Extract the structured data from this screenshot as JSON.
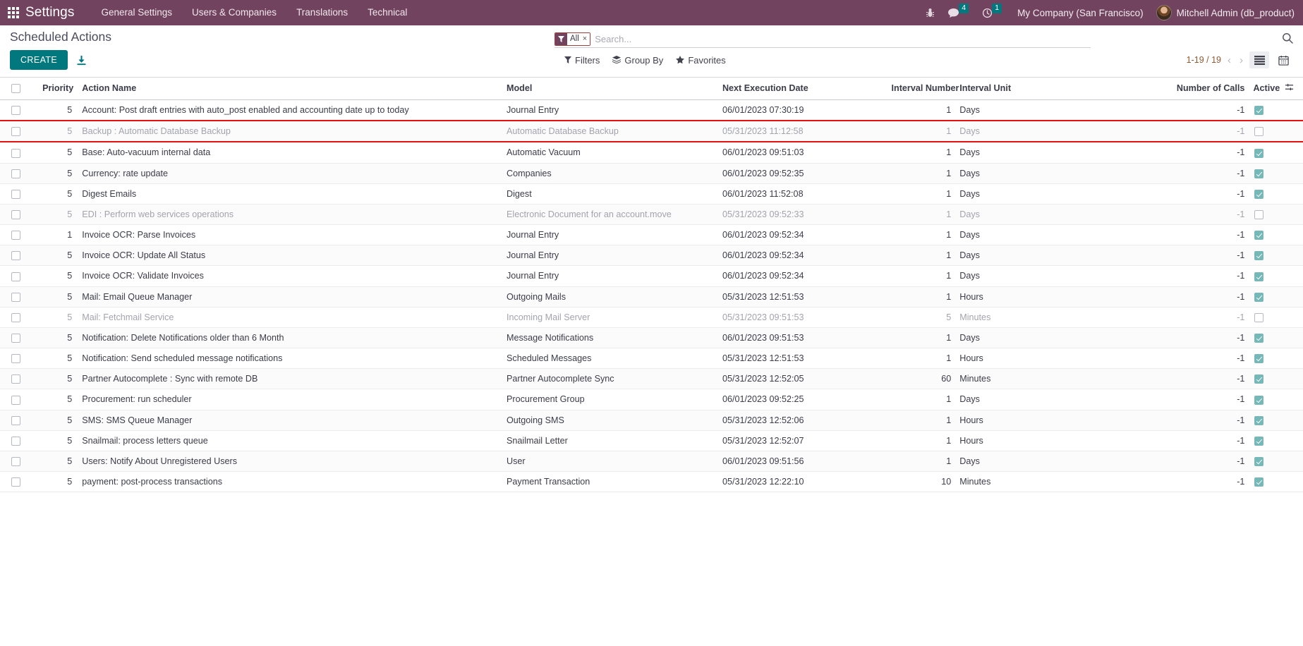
{
  "navbar": {
    "apps_icon": "apps-grid-icon",
    "brand": "Settings",
    "menu": [
      {
        "label": "General Settings"
      },
      {
        "label": "Users & Companies"
      },
      {
        "label": "Translations"
      },
      {
        "label": "Technical"
      }
    ],
    "debug_icon": "bug-icon",
    "messages": {
      "icon": "messages-icon",
      "count": "4"
    },
    "activities": {
      "icon": "clock-icon",
      "count": "1"
    },
    "company": "My Company (San Francisco)",
    "user": "Mitchell Admin (db_product)",
    "accent_color": "#71435f",
    "badge_color": "#00787d"
  },
  "control_panel": {
    "breadcrumb": "Scheduled Actions",
    "create_label": "CREATE",
    "upload_icon": "upload-icon",
    "search": {
      "facet_icon": "filter-icon",
      "facet_label": "All",
      "facet_remove": "×",
      "placeholder": "Search...",
      "value": "",
      "magnifier_icon": "search-icon"
    },
    "filters": [
      {
        "label": "Filters",
        "icon": "filter-icon"
      },
      {
        "label": "Group By",
        "icon": "layers-icon"
      },
      {
        "label": "Favorites",
        "icon": "star-icon"
      }
    ],
    "pager": {
      "value": "1-19 / 19",
      "prev_icon": "chevron-left-icon",
      "next_icon": "chevron-right-icon"
    },
    "views": [
      {
        "name": "list-view",
        "icon": "list-icon",
        "active": true
      },
      {
        "name": "calendar-view",
        "icon": "calendar-icon",
        "active": false
      }
    ]
  },
  "table": {
    "columns": [
      "Priority",
      "Action Name",
      "Model",
      "Next Execution Date",
      "Interval Number",
      "Interval Unit",
      "Number of Calls",
      "Active"
    ],
    "options_icon": "column-options-icon",
    "rows": [
      {
        "priority": "5",
        "name": "Account: Post draft entries with auto_post enabled and accounting date up to today",
        "model": "Journal Entry",
        "next_exec": "06/01/2023 07:30:19",
        "interval_number": "1",
        "interval_unit": "Days",
        "number_of_calls": "-1",
        "active": true,
        "muted": false,
        "highlighted": false
      },
      {
        "priority": "5",
        "name": "Backup : Automatic Database Backup",
        "model": "Automatic Database Backup",
        "next_exec": "05/31/2023 11:12:58",
        "interval_number": "1",
        "interval_unit": "Days",
        "number_of_calls": "-1",
        "active": false,
        "muted": true,
        "highlighted": true
      },
      {
        "priority": "5",
        "name": "Base: Auto-vacuum internal data",
        "model": "Automatic Vacuum",
        "next_exec": "06/01/2023 09:51:03",
        "interval_number": "1",
        "interval_unit": "Days",
        "number_of_calls": "-1",
        "active": true,
        "muted": false,
        "highlighted": false
      },
      {
        "priority": "5",
        "name": "Currency: rate update",
        "model": "Companies",
        "next_exec": "06/01/2023 09:52:35",
        "interval_number": "1",
        "interval_unit": "Days",
        "number_of_calls": "-1",
        "active": true,
        "muted": false,
        "highlighted": false
      },
      {
        "priority": "5",
        "name": "Digest Emails",
        "model": "Digest",
        "next_exec": "06/01/2023 11:52:08",
        "interval_number": "1",
        "interval_unit": "Days",
        "number_of_calls": "-1",
        "active": true,
        "muted": false,
        "highlighted": false
      },
      {
        "priority": "5",
        "name": "EDI : Perform web services operations",
        "model": "Electronic Document for an account.move",
        "next_exec": "05/31/2023 09:52:33",
        "interval_number": "1",
        "interval_unit": "Days",
        "number_of_calls": "-1",
        "active": false,
        "muted": true,
        "highlighted": false
      },
      {
        "priority": "1",
        "name": "Invoice OCR: Parse Invoices",
        "model": "Journal Entry",
        "next_exec": "06/01/2023 09:52:34",
        "interval_number": "1",
        "interval_unit": "Days",
        "number_of_calls": "-1",
        "active": true,
        "muted": false,
        "highlighted": false
      },
      {
        "priority": "5",
        "name": "Invoice OCR: Update All Status",
        "model": "Journal Entry",
        "next_exec": "06/01/2023 09:52:34",
        "interval_number": "1",
        "interval_unit": "Days",
        "number_of_calls": "-1",
        "active": true,
        "muted": false,
        "highlighted": false
      },
      {
        "priority": "5",
        "name": "Invoice OCR: Validate Invoices",
        "model": "Journal Entry",
        "next_exec": "06/01/2023 09:52:34",
        "interval_number": "1",
        "interval_unit": "Days",
        "number_of_calls": "-1",
        "active": true,
        "muted": false,
        "highlighted": false
      },
      {
        "priority": "5",
        "name": "Mail: Email Queue Manager",
        "model": "Outgoing Mails",
        "next_exec": "05/31/2023 12:51:53",
        "interval_number": "1",
        "interval_unit": "Hours",
        "number_of_calls": "-1",
        "active": true,
        "muted": false,
        "highlighted": false
      },
      {
        "priority": "5",
        "name": "Mail: Fetchmail Service",
        "model": "Incoming Mail Server",
        "next_exec": "05/31/2023 09:51:53",
        "interval_number": "5",
        "interval_unit": "Minutes",
        "number_of_calls": "-1",
        "active": false,
        "muted": true,
        "highlighted": false
      },
      {
        "priority": "5",
        "name": "Notification: Delete Notifications older than 6 Month",
        "model": "Message Notifications",
        "next_exec": "06/01/2023 09:51:53",
        "interval_number": "1",
        "interval_unit": "Days",
        "number_of_calls": "-1",
        "active": true,
        "muted": false,
        "highlighted": false
      },
      {
        "priority": "5",
        "name": "Notification: Send scheduled message notifications",
        "model": "Scheduled Messages",
        "next_exec": "05/31/2023 12:51:53",
        "interval_number": "1",
        "interval_unit": "Hours",
        "number_of_calls": "-1",
        "active": true,
        "muted": false,
        "highlighted": false
      },
      {
        "priority": "5",
        "name": "Partner Autocomplete : Sync with remote DB",
        "model": "Partner Autocomplete Sync",
        "next_exec": "05/31/2023 12:52:05",
        "interval_number": "60",
        "interval_unit": "Minutes",
        "number_of_calls": "-1",
        "active": true,
        "muted": false,
        "highlighted": false
      },
      {
        "priority": "5",
        "name": "Procurement: run scheduler",
        "model": "Procurement Group",
        "next_exec": "06/01/2023 09:52:25",
        "interval_number": "1",
        "interval_unit": "Days",
        "number_of_calls": "-1",
        "active": true,
        "muted": false,
        "highlighted": false
      },
      {
        "priority": "5",
        "name": "SMS: SMS Queue Manager",
        "model": "Outgoing SMS",
        "next_exec": "05/31/2023 12:52:06",
        "interval_number": "1",
        "interval_unit": "Hours",
        "number_of_calls": "-1",
        "active": true,
        "muted": false,
        "highlighted": false
      },
      {
        "priority": "5",
        "name": "Snailmail: process letters queue",
        "model": "Snailmail Letter",
        "next_exec": "05/31/2023 12:52:07",
        "interval_number": "1",
        "interval_unit": "Hours",
        "number_of_calls": "-1",
        "active": true,
        "muted": false,
        "highlighted": false
      },
      {
        "priority": "5",
        "name": "Users: Notify About Unregistered Users",
        "model": "User",
        "next_exec": "06/01/2023 09:51:56",
        "interval_number": "1",
        "interval_unit": "Days",
        "number_of_calls": "-1",
        "active": true,
        "muted": false,
        "highlighted": false
      },
      {
        "priority": "5",
        "name": "payment: post-process transactions",
        "model": "Payment Transaction",
        "next_exec": "05/31/2023 12:22:10",
        "interval_number": "10",
        "interval_unit": "Minutes",
        "number_of_calls": "-1",
        "active": true,
        "muted": false,
        "highlighted": false
      }
    ]
  }
}
